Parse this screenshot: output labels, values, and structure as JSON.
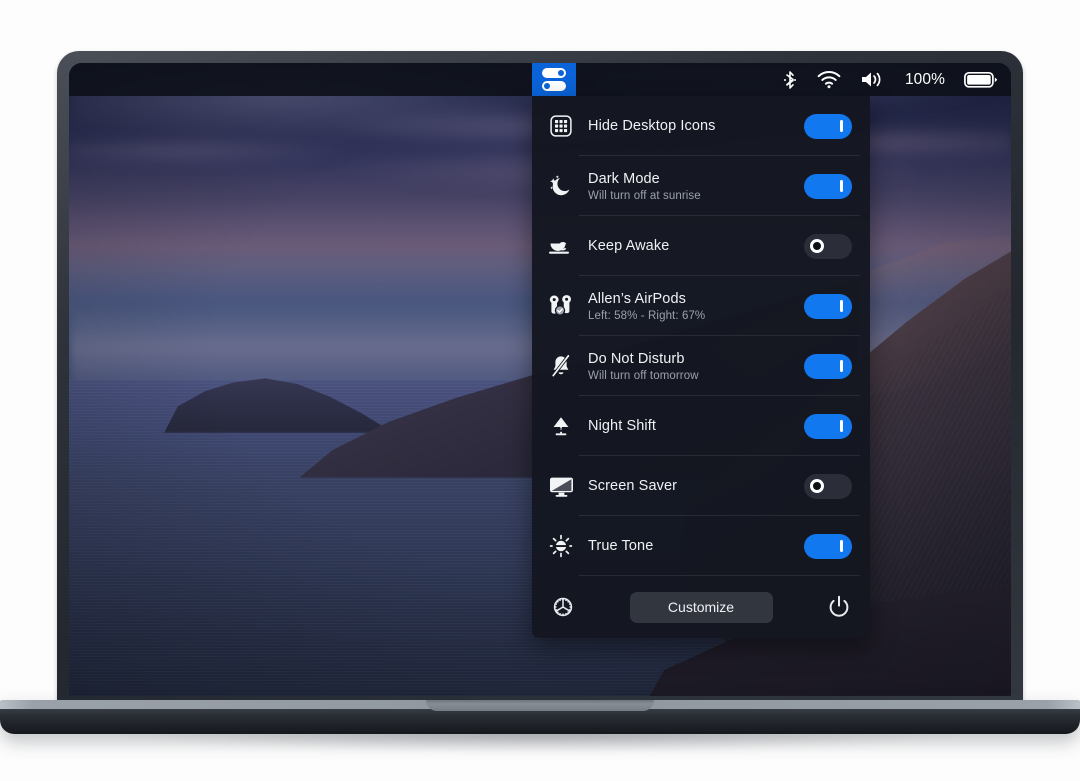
{
  "menubar": {
    "app_icon_name": "toggles-icon",
    "battery_percent": "100%",
    "items": [
      {
        "name": "bluetooth-icon",
        "label": "Bluetooth"
      },
      {
        "name": "wifi-icon",
        "label": "Wi-Fi"
      },
      {
        "name": "volume-icon",
        "label": "Volume"
      },
      {
        "name": "battery-icon",
        "label": "Battery"
      }
    ]
  },
  "panel": {
    "rows": [
      {
        "icon": "desktop-grid-icon",
        "title": "Hide Desktop Icons",
        "subtitle": "",
        "state": "on"
      },
      {
        "icon": "moon-icon",
        "title": "Dark Mode",
        "subtitle": "Will turn off at sunrise",
        "state": "on"
      },
      {
        "icon": "coffee-cup-icon",
        "title": "Keep Awake",
        "subtitle": "",
        "state": "off"
      },
      {
        "icon": "airpods-icon",
        "title": "Allen’s AirPods",
        "subtitle": "Left: 58% - Right: 67%",
        "state": "on"
      },
      {
        "icon": "bell-slash-icon",
        "title": "Do Not Disturb",
        "subtitle": "Will turn off tomorrow",
        "state": "on"
      },
      {
        "icon": "desk-lamp-icon",
        "title": "Night Shift",
        "subtitle": "",
        "state": "on"
      },
      {
        "icon": "display-icon",
        "title": "Screen Saver",
        "subtitle": "",
        "state": "off"
      },
      {
        "icon": "sun-truetone-icon",
        "title": "True Tone",
        "subtitle": "",
        "state": "on"
      }
    ],
    "footer": {
      "settings_icon": "gear-icon",
      "customize_label": "Customize",
      "power_icon": "power-icon"
    }
  },
  "colors": {
    "accent_on": "#1278f0",
    "toggle_off": "#2b2e38",
    "panel_bg": "#141720",
    "menubar_highlight": "#0a63d8",
    "text_primary": "#f0f1f4",
    "text_secondary": "#9aa0ad"
  }
}
